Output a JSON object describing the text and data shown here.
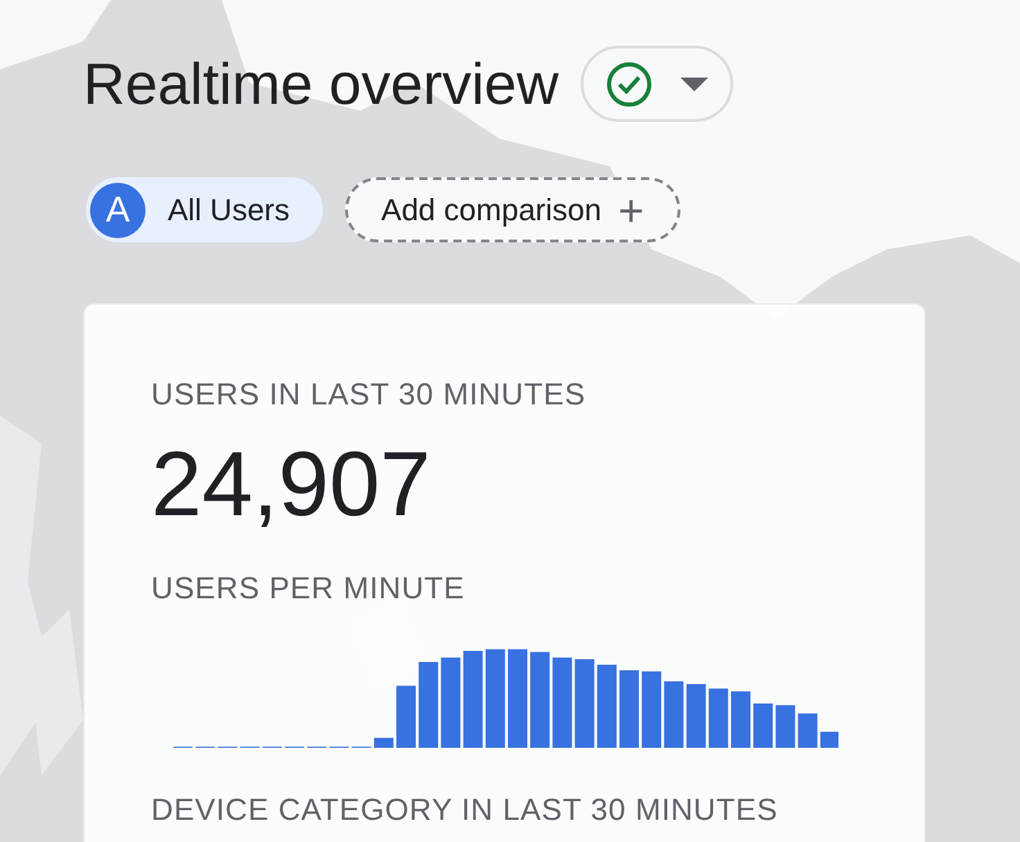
{
  "header": {
    "title": "Realtime overview"
  },
  "chips": [
    {
      "kind": "segment",
      "avatar": "A",
      "label": "All Users"
    },
    {
      "kind": "add",
      "label": "Add comparison",
      "icon": "+"
    }
  ],
  "card": {
    "users_label": "USERS IN LAST 30 MINUTES",
    "users_value": "24,907",
    "per_minute_label": "USERS PER MINUTE",
    "device_label": "DEVICE CATEGORY IN LAST 30 MINUTES"
  }
}
